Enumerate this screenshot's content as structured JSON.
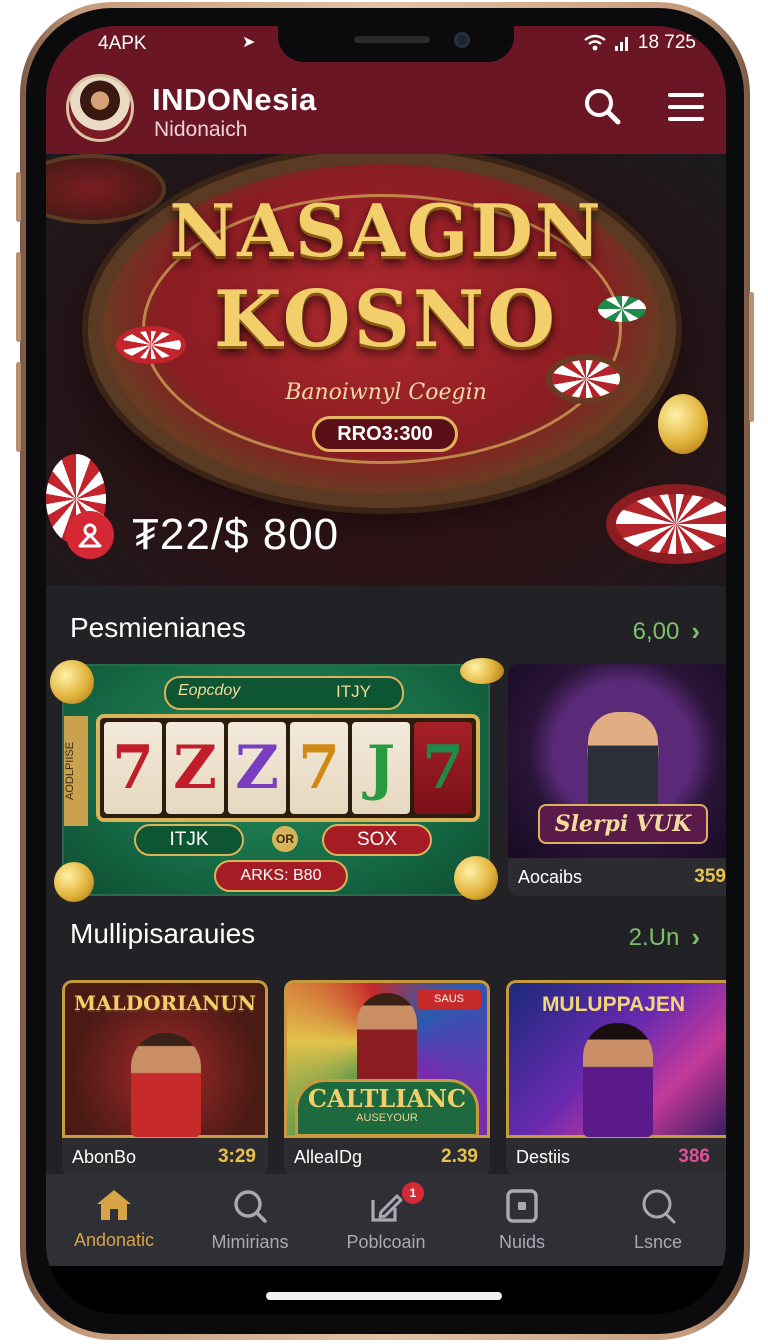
{
  "status": {
    "left": "4APK",
    "right": "18 725"
  },
  "header": {
    "title": "INDONesia",
    "subtitle": "Nidonaich"
  },
  "hero": {
    "title_line1": "NASAGDN",
    "title_line2": "KOSNO",
    "tagline": "Banoiwnyl Coegin",
    "pill": "RRO3:300",
    "jackpot": "₮22/$ 800"
  },
  "section1": {
    "title": "Pesmienianes",
    "more": "6,00",
    "slot": {
      "header_left": "Eopcdoy",
      "header_right": "ITJY",
      "reels": [
        "7",
        "Z",
        "Z",
        "7",
        "J",
        "7"
      ],
      "side_label": "AODLPIISE",
      "btn_left": "ITJK",
      "btn_or": "OR",
      "btn_right": "SOX",
      "btn_bottom": "ARKS: B80"
    },
    "card2": {
      "banner": "Slerpi VUK",
      "name": "Aocaibs",
      "value": "359"
    }
  },
  "section2": {
    "title": "Mullipisarauies",
    "more": "2.Un",
    "cards": [
      {
        "banner": "MALDORIANUN",
        "name": "AbonBo",
        "value": "3:29"
      },
      {
        "banner": "CALTLIANC",
        "sub": "AUSEYOUR",
        "tag": "SAUS",
        "name": "AlleaIDg",
        "value": "2.39"
      },
      {
        "banner": "MULUPPAJEN",
        "name": "Destiis",
        "value": "386"
      }
    ]
  },
  "nav": [
    {
      "label": "Andonatic",
      "icon": "home-icon"
    },
    {
      "label": "Mimirians",
      "icon": "search-icon"
    },
    {
      "label": "Poblcoain",
      "icon": "edit-icon",
      "badge": "1"
    },
    {
      "label": "Nuids",
      "icon": "square-icon"
    },
    {
      "label": "Lsnce",
      "icon": "search-icon"
    }
  ],
  "colors": {
    "accent": "#d7a447",
    "header": "#6a1624",
    "more": "#7fbf6a",
    "gold": "#e9c24b",
    "pink": "#e0509a"
  }
}
